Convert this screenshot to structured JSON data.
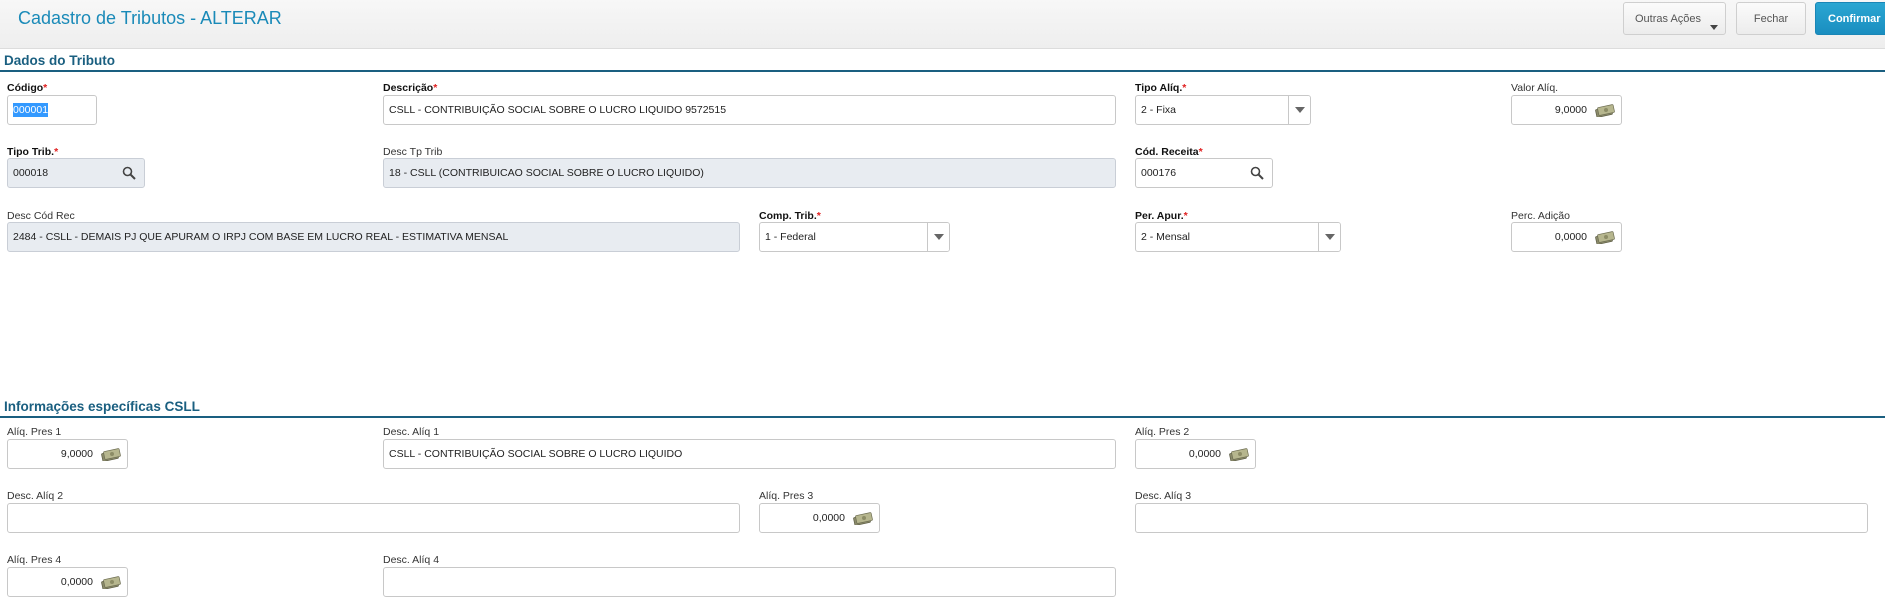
{
  "header": {
    "title": "Cadastro de Tributos - ALTERAR",
    "buttons": {
      "outras_acoes": "Outras Ações",
      "fechar": "Fechar",
      "confirmar": "Confirmar"
    }
  },
  "sections": {
    "dados": "Dados do Tributo",
    "csll": "Informações específicas CSLL"
  },
  "required_mark": "*",
  "fields": {
    "codigo": {
      "label": "Código",
      "value": "000001"
    },
    "descricao": {
      "label": "Descrição",
      "value": "CSLL - CONTRIBUIÇÃO SOCIAL SOBRE O LUCRO LIQUIDO  9572515"
    },
    "tipo_aliq": {
      "label": "Tipo Alíq.",
      "value": "2 - Fixa"
    },
    "valor_aliq": {
      "label": "Valor Alíq.",
      "value": "9,0000"
    },
    "tipo_trib": {
      "label": "Tipo Trib.",
      "value": "000018"
    },
    "desc_tp_trib": {
      "label": "Desc Tp Trib",
      "value": "18 - CSLL (CONTRIBUICAO SOCIAL SOBRE O LUCRO LIQUIDO)"
    },
    "cod_receita": {
      "label": "Cód. Receita",
      "value": "000176"
    },
    "desc_cod_rec": {
      "label": "Desc Cód Rec",
      "value": "2484 - CSLL - DEMAIS PJ QUE APURAM O IRPJ COM BASE EM LUCRO REAL - ESTIMATIVA MENSAL"
    },
    "comp_trib": {
      "label": "Comp. Trib.",
      "value": "1 - Federal"
    },
    "per_apur": {
      "label": "Per. Apur.",
      "value": "2 - Mensal"
    },
    "perc_adicao": {
      "label": "Perc. Adição",
      "value": "0,0000"
    },
    "aliq_pres_1": {
      "label": "Alíq. Pres 1",
      "value": "9,0000"
    },
    "desc_aliq_1": {
      "label": "Desc. Alíq 1",
      "value": "CSLL - CONTRIBUIÇÃO SOCIAL SOBRE O LUCRO LIQUIDO"
    },
    "aliq_pres_2": {
      "label": "Alíq. Pres 2",
      "value": "0,0000"
    },
    "desc_aliq_2": {
      "label": "Desc. Alíq 2",
      "value": ""
    },
    "aliq_pres_3": {
      "label": "Alíq. Pres 3",
      "value": "0,0000"
    },
    "desc_aliq_3": {
      "label": "Desc. Alíq 3",
      "value": ""
    },
    "aliq_pres_4": {
      "label": "Alíq. Pres 4",
      "value": "0,0000"
    },
    "desc_aliq_4": {
      "label": "Desc. Alíq 4",
      "value": ""
    }
  },
  "icons": {
    "lookup": "search-icon",
    "currency": "money-icon",
    "dropdown": "chevron-down-icon"
  },
  "colors": {
    "title": "#1a8ab8",
    "section": "#1a5f80",
    "confirm": "#1a8ec0",
    "required": "#e02020",
    "readonly_bg": "#e8ecf1"
  }
}
